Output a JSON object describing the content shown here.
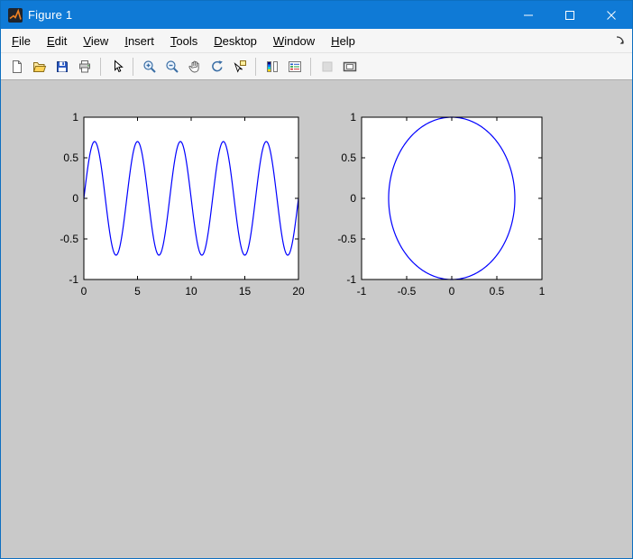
{
  "window": {
    "title": "Figure 1",
    "app_icon": "matlab-icon",
    "controls": [
      {
        "name": "minimize",
        "icon": "minimize-icon"
      },
      {
        "name": "maximize",
        "icon": "maximize-icon"
      },
      {
        "name": "close",
        "icon": "close-icon"
      }
    ]
  },
  "menubar": {
    "items": [
      {
        "label": "File",
        "mnemonic": "F"
      },
      {
        "label": "Edit",
        "mnemonic": "E"
      },
      {
        "label": "View",
        "mnemonic": "V"
      },
      {
        "label": "Insert",
        "mnemonic": "I"
      },
      {
        "label": "Tools",
        "mnemonic": "T"
      },
      {
        "label": "Desktop",
        "mnemonic": "D"
      },
      {
        "label": "Window",
        "mnemonic": "W"
      },
      {
        "label": "Help",
        "mnemonic": "H"
      }
    ],
    "dock_arrow_icon": "dock-arrow-icon"
  },
  "toolbar": {
    "groups": [
      {
        "buttons": [
          {
            "name": "new-figure",
            "icon": "new-document-icon",
            "enabled": true
          },
          {
            "name": "open-file",
            "icon": "open-folder-icon",
            "enabled": true
          },
          {
            "name": "save-figure",
            "icon": "save-icon",
            "enabled": true
          },
          {
            "name": "print-figure",
            "icon": "print-icon",
            "enabled": true
          }
        ]
      },
      {
        "buttons": [
          {
            "name": "edit-plot",
            "icon": "pointer-icon",
            "enabled": true
          }
        ]
      },
      {
        "buttons": [
          {
            "name": "zoom-in",
            "icon": "zoom-in-icon",
            "enabled": true
          },
          {
            "name": "zoom-out",
            "icon": "zoom-out-icon",
            "enabled": true
          },
          {
            "name": "pan",
            "icon": "pan-hand-icon",
            "enabled": true
          },
          {
            "name": "rotate-3d",
            "icon": "rotate-3d-icon",
            "enabled": true
          },
          {
            "name": "data-cursor",
            "icon": "data-cursor-icon",
            "enabled": true
          }
        ]
      },
      {
        "buttons": [
          {
            "name": "insert-colorbar",
            "icon": "colorbar-icon",
            "enabled": true
          },
          {
            "name": "insert-legend",
            "icon": "legend-icon",
            "enabled": true
          }
        ]
      },
      {
        "buttons": [
          {
            "name": "hide-plot-tools",
            "icon": "brush-icon",
            "enabled": false
          },
          {
            "name": "show-plot-tools",
            "icon": "plot-tools-icon",
            "enabled": true
          }
        ]
      }
    ]
  },
  "colors": {
    "titlebar": "#0f7ad6",
    "client_background": "#c9c9c9",
    "plot_background": "#ffffff",
    "axis": "#000000",
    "line": "#0000ff"
  },
  "chart_data": [
    {
      "type": "line",
      "subplot": "left",
      "title": "",
      "xlabel": "",
      "ylabel": "",
      "xlim": [
        0,
        20
      ],
      "ylim": [
        -1,
        1
      ],
      "xticks": [
        "0",
        "5",
        "10",
        "15",
        "20"
      ],
      "yticks": [
        "-1",
        "-0.5",
        "0",
        "0.5",
        "1"
      ],
      "grid": false,
      "legend": null,
      "line_color": "#0000ff",
      "series": [
        {
          "name": "y = 0.7*sin(pi*x/2)",
          "kind": "sine",
          "amplitude": 0.7,
          "period": 4,
          "phase": 0,
          "x_start": 0,
          "x_end": 20,
          "cycles_shown": 5
        }
      ]
    },
    {
      "type": "line",
      "subplot": "right",
      "title": "",
      "xlabel": "",
      "ylabel": "",
      "xlim": [
        -1,
        1
      ],
      "ylim": [
        -1,
        1
      ],
      "xticks": [
        "-1",
        "-0.5",
        "0",
        "0.5",
        "1"
      ],
      "yticks": [
        "-1",
        "-0.5",
        "0",
        "0.5",
        "1"
      ],
      "grid": false,
      "legend": null,
      "line_color": "#0000ff",
      "series": [
        {
          "name": "closed curve (x = 0.7*cos t, y = sin t)",
          "kind": "ellipse",
          "cx": 0,
          "cy": 0,
          "rx": 0.7,
          "ry": 1.0
        }
      ]
    }
  ]
}
